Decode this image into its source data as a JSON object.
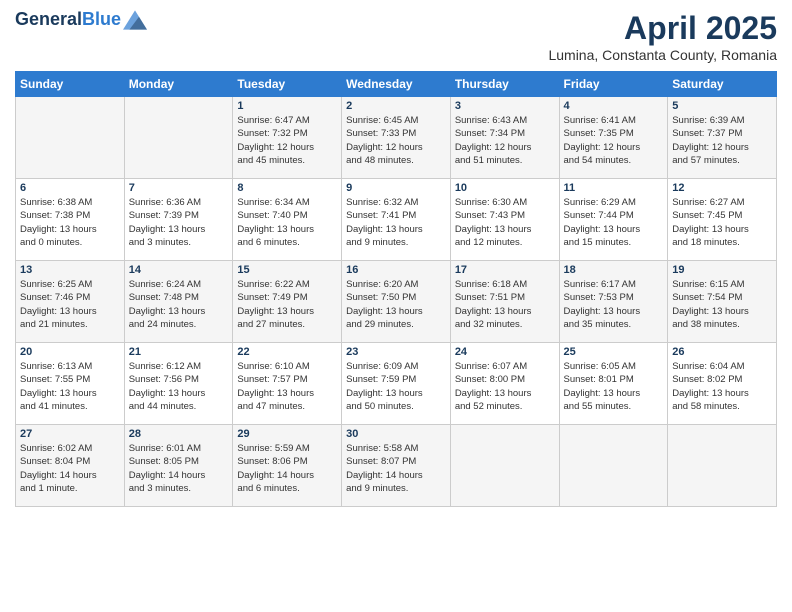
{
  "header": {
    "logo_line1": "General",
    "logo_line2": "Blue",
    "month": "April 2025",
    "location": "Lumina, Constanta County, Romania"
  },
  "weekdays": [
    "Sunday",
    "Monday",
    "Tuesday",
    "Wednesday",
    "Thursday",
    "Friday",
    "Saturday"
  ],
  "weeks": [
    [
      {
        "day": "",
        "info": ""
      },
      {
        "day": "",
        "info": ""
      },
      {
        "day": "1",
        "info": "Sunrise: 6:47 AM\nSunset: 7:32 PM\nDaylight: 12 hours\nand 45 minutes."
      },
      {
        "day": "2",
        "info": "Sunrise: 6:45 AM\nSunset: 7:33 PM\nDaylight: 12 hours\nand 48 minutes."
      },
      {
        "day": "3",
        "info": "Sunrise: 6:43 AM\nSunset: 7:34 PM\nDaylight: 12 hours\nand 51 minutes."
      },
      {
        "day": "4",
        "info": "Sunrise: 6:41 AM\nSunset: 7:35 PM\nDaylight: 12 hours\nand 54 minutes."
      },
      {
        "day": "5",
        "info": "Sunrise: 6:39 AM\nSunset: 7:37 PM\nDaylight: 12 hours\nand 57 minutes."
      }
    ],
    [
      {
        "day": "6",
        "info": "Sunrise: 6:38 AM\nSunset: 7:38 PM\nDaylight: 13 hours\nand 0 minutes."
      },
      {
        "day": "7",
        "info": "Sunrise: 6:36 AM\nSunset: 7:39 PM\nDaylight: 13 hours\nand 3 minutes."
      },
      {
        "day": "8",
        "info": "Sunrise: 6:34 AM\nSunset: 7:40 PM\nDaylight: 13 hours\nand 6 minutes."
      },
      {
        "day": "9",
        "info": "Sunrise: 6:32 AM\nSunset: 7:41 PM\nDaylight: 13 hours\nand 9 minutes."
      },
      {
        "day": "10",
        "info": "Sunrise: 6:30 AM\nSunset: 7:43 PM\nDaylight: 13 hours\nand 12 minutes."
      },
      {
        "day": "11",
        "info": "Sunrise: 6:29 AM\nSunset: 7:44 PM\nDaylight: 13 hours\nand 15 minutes."
      },
      {
        "day": "12",
        "info": "Sunrise: 6:27 AM\nSunset: 7:45 PM\nDaylight: 13 hours\nand 18 minutes."
      }
    ],
    [
      {
        "day": "13",
        "info": "Sunrise: 6:25 AM\nSunset: 7:46 PM\nDaylight: 13 hours\nand 21 minutes."
      },
      {
        "day": "14",
        "info": "Sunrise: 6:24 AM\nSunset: 7:48 PM\nDaylight: 13 hours\nand 24 minutes."
      },
      {
        "day": "15",
        "info": "Sunrise: 6:22 AM\nSunset: 7:49 PM\nDaylight: 13 hours\nand 27 minutes."
      },
      {
        "day": "16",
        "info": "Sunrise: 6:20 AM\nSunset: 7:50 PM\nDaylight: 13 hours\nand 29 minutes."
      },
      {
        "day": "17",
        "info": "Sunrise: 6:18 AM\nSunset: 7:51 PM\nDaylight: 13 hours\nand 32 minutes."
      },
      {
        "day": "18",
        "info": "Sunrise: 6:17 AM\nSunset: 7:53 PM\nDaylight: 13 hours\nand 35 minutes."
      },
      {
        "day": "19",
        "info": "Sunrise: 6:15 AM\nSunset: 7:54 PM\nDaylight: 13 hours\nand 38 minutes."
      }
    ],
    [
      {
        "day": "20",
        "info": "Sunrise: 6:13 AM\nSunset: 7:55 PM\nDaylight: 13 hours\nand 41 minutes."
      },
      {
        "day": "21",
        "info": "Sunrise: 6:12 AM\nSunset: 7:56 PM\nDaylight: 13 hours\nand 44 minutes."
      },
      {
        "day": "22",
        "info": "Sunrise: 6:10 AM\nSunset: 7:57 PM\nDaylight: 13 hours\nand 47 minutes."
      },
      {
        "day": "23",
        "info": "Sunrise: 6:09 AM\nSunset: 7:59 PM\nDaylight: 13 hours\nand 50 minutes."
      },
      {
        "day": "24",
        "info": "Sunrise: 6:07 AM\nSunset: 8:00 PM\nDaylight: 13 hours\nand 52 minutes."
      },
      {
        "day": "25",
        "info": "Sunrise: 6:05 AM\nSunset: 8:01 PM\nDaylight: 13 hours\nand 55 minutes."
      },
      {
        "day": "26",
        "info": "Sunrise: 6:04 AM\nSunset: 8:02 PM\nDaylight: 13 hours\nand 58 minutes."
      }
    ],
    [
      {
        "day": "27",
        "info": "Sunrise: 6:02 AM\nSunset: 8:04 PM\nDaylight: 14 hours\nand 1 minute."
      },
      {
        "day": "28",
        "info": "Sunrise: 6:01 AM\nSunset: 8:05 PM\nDaylight: 14 hours\nand 3 minutes."
      },
      {
        "day": "29",
        "info": "Sunrise: 5:59 AM\nSunset: 8:06 PM\nDaylight: 14 hours\nand 6 minutes."
      },
      {
        "day": "30",
        "info": "Sunrise: 5:58 AM\nSunset: 8:07 PM\nDaylight: 14 hours\nand 9 minutes."
      },
      {
        "day": "",
        "info": ""
      },
      {
        "day": "",
        "info": ""
      },
      {
        "day": "",
        "info": ""
      }
    ]
  ]
}
